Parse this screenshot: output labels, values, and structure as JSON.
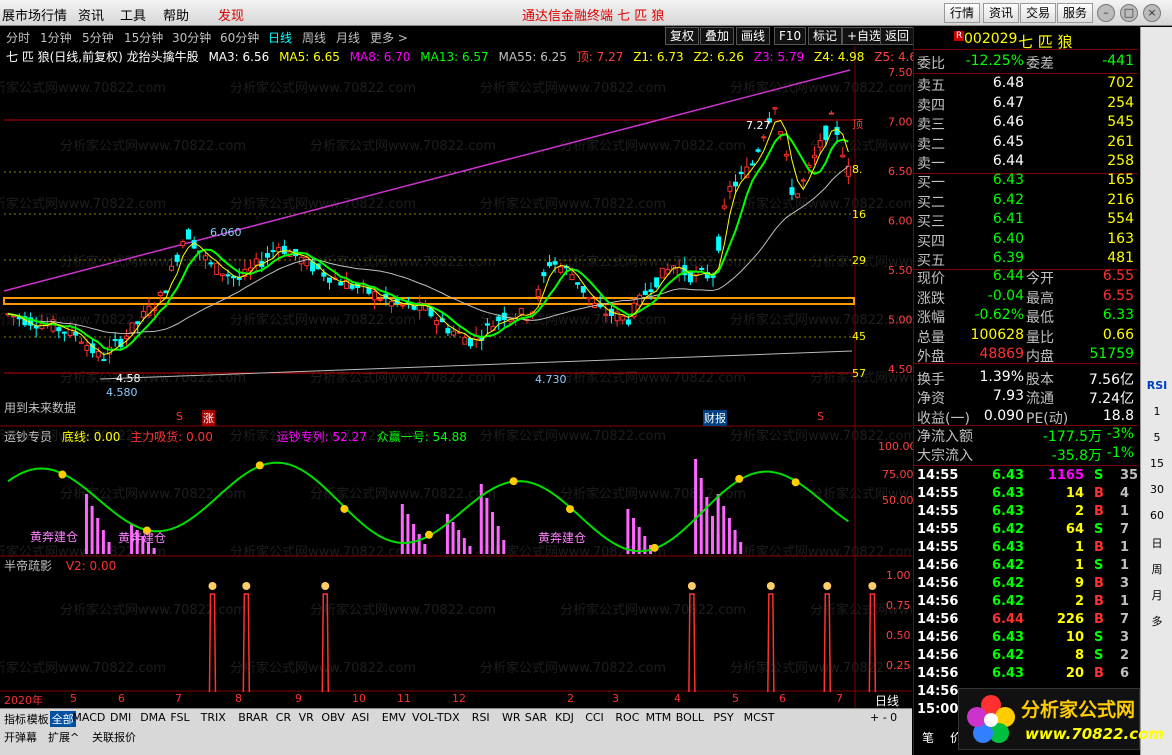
{
  "menu": {
    "items": [
      "展市场行情",
      "资讯",
      "工具",
      "帮助",
      "发现"
    ],
    "title": "通达信金融终端  七 匹 狼",
    "right_buttons": [
      "行情",
      "资讯",
      "交易",
      "服务"
    ]
  },
  "period": {
    "items": [
      "分时",
      "1分钟",
      "5分钟",
      "15分钟",
      "30分钟",
      "日线",
      "周线",
      "月线",
      "更多 >"
    ],
    "active": "日线"
  },
  "toolbtns": [
    "复权",
    "叠加",
    "画线",
    "F10",
    "标记",
    "+自选",
    "返回"
  ],
  "legend": {
    "name": "七 匹 狼(日线,前复权) 龙抬头擒牛股",
    "ma3": "MA3: 6.56",
    "ma5": "MA5: 6.65",
    "ma8": "MA8: 6.70",
    "ma13": "MA13: 6.57",
    "ma55": "MA55: 6.25",
    "ding": "顶: 7.27",
    "z1": "Z1: 6.73",
    "z2": "Z2: 6.26",
    "z3": "Z3: 5.79",
    "z4": "Z4: 4.98",
    "z5": "Z5: 4.6"
  },
  "colors": {
    "ma3": "#ffffff",
    "ma5": "#ffff00",
    "ma8": "#ff00ff",
    "ma13": "#00ff00",
    "ma55": "#c0c0c0",
    "up": "#ff3030",
    "down": "#00ffff",
    "tri": "#cc33cc",
    "support": "#ff9900"
  },
  "price_axis": [
    "7.50",
    "7.00",
    "6.50",
    "6.00",
    "5.50",
    "5.00",
    "4.50"
  ],
  "price_axis_values": [
    7.5,
    7.0,
    6.5,
    6.0,
    5.5,
    5.0,
    4.5
  ],
  "right_marks": [
    "顶",
    "8.",
    "16",
    "29",
    "45",
    "57"
  ],
  "annotations": {
    "high": "7.27",
    "peak1": "6.060",
    "low1": "4.58",
    "low1b": "4.580",
    "low2": "4.730",
    "note": "用到未来数据",
    "zhang": "涨",
    "caibao": "财报",
    "s": "S"
  },
  "ind1": {
    "title": "运钞专员",
    "dx": "底线: 0.00",
    "zl": "主力吸货: 0.00",
    "yc": "运钞专列: 52.27",
    "zy": "众赢一号: 54.88",
    "labels": [
      "黄奔建仓",
      "黄奔建仓",
      "黄奔建仓"
    ],
    "axis": [
      "100.00",
      "75.00",
      "50.00"
    ]
  },
  "ind2": {
    "title": "半帝疏影",
    "v2": "V2: 0.00",
    "axis": [
      "1.00",
      "0.75",
      "0.50",
      "0.25"
    ]
  },
  "xaxis": {
    "labels": [
      "2020年",
      "5",
      "6",
      "7",
      "8",
      "9",
      "10",
      "11",
      "12",
      "2",
      "3",
      "4",
      "5",
      "6",
      "7"
    ],
    "period": "日线"
  },
  "bottom": {
    "row1": [
      "指标",
      "模板",
      "全部",
      "MACD",
      "DMI",
      "DMA",
      "FSL",
      "TRIX",
      "BRAR",
      "CR",
      "VR",
      "OBV",
      "ASI",
      "EMV",
      "VOL-TDX",
      "RSI",
      "WR",
      "SAR",
      "KDJ",
      "CCI",
      "ROC",
      "MTM",
      "BOLL",
      "PSY",
      "MCST"
    ],
    "row2": [
      "开弹幕",
      "扩展^",
      "关联报价"
    ]
  },
  "quote": {
    "code": "002029",
    "name": "七 匹 狼",
    "weibi": {
      "k": "委比",
      "v": "-12.25%",
      "k2": "委差",
      "v2": "-441"
    },
    "asks": [
      {
        "k": "卖五",
        "p": "6.48",
        "v": "702"
      },
      {
        "k": "卖四",
        "p": "6.47",
        "v": "254"
      },
      {
        "k": "卖三",
        "p": "6.46",
        "v": "545"
      },
      {
        "k": "卖二",
        "p": "6.45",
        "v": "261"
      },
      {
        "k": "卖一",
        "p": "6.44",
        "v": "258"
      }
    ],
    "bids": [
      {
        "k": "买一",
        "p": "6.43",
        "v": "165"
      },
      {
        "k": "买二",
        "p": "6.42",
        "v": "216"
      },
      {
        "k": "买三",
        "p": "6.41",
        "v": "554"
      },
      {
        "k": "买四",
        "p": "6.40",
        "v": "163"
      },
      {
        "k": "买五",
        "p": "6.39",
        "v": "481"
      }
    ],
    "stats": [
      [
        "现价",
        "6.44",
        "今开",
        "6.55"
      ],
      [
        "涨跌",
        "-0.04",
        "最高",
        "6.55"
      ],
      [
        "涨幅",
        "-0.62%",
        "最低",
        "6.33"
      ],
      [
        "总量",
        "100628",
        "量比",
        "0.66"
      ],
      [
        "外盘",
        "48869",
        "内盘",
        "51759"
      ],
      [
        "换手",
        "1.39%",
        "股本",
        "7.56亿"
      ],
      [
        "净资",
        "7.93",
        "流通",
        "7.24亿"
      ],
      [
        "收益(一)",
        "0.090",
        "PE(动)",
        "18.8"
      ]
    ],
    "flow": [
      [
        "净流入额",
        "-177.5万",
        "-3%"
      ],
      [
        "大宗流入",
        "-35.8万",
        "-1%"
      ]
    ],
    "ticks": [
      [
        "14:55",
        "6.43",
        "1165",
        "S",
        "35"
      ],
      [
        "14:55",
        "6.43",
        "14",
        "B",
        "4"
      ],
      [
        "14:55",
        "6.43",
        "2",
        "B",
        "1"
      ],
      [
        "14:55",
        "6.42",
        "64",
        "S",
        "7"
      ],
      [
        "14:55",
        "6.43",
        "1",
        "B",
        "1"
      ],
      [
        "14:56",
        "6.42",
        "1",
        "S",
        "1"
      ],
      [
        "14:56",
        "6.42",
        "9",
        "B",
        "3"
      ],
      [
        "14:56",
        "6.42",
        "2",
        "B",
        "1"
      ],
      [
        "14:56",
        "6.44",
        "226",
        "B",
        "7"
      ],
      [
        "14:56",
        "6.43",
        "10",
        "S",
        "3"
      ],
      [
        "14:56",
        "6.42",
        "8",
        "S",
        "2"
      ],
      [
        "14:56",
        "6.43",
        "20",
        "B",
        "6"
      ],
      [
        "14:56",
        "",
        "",
        "",
        ""
      ],
      [
        "15:00",
        "",
        "",
        "",
        ""
      ]
    ],
    "tabs": [
      "笔",
      "价"
    ]
  },
  "sidebar": [
    "RSI",
    "1",
    "5",
    "15",
    "30",
    "60",
    "日",
    "周",
    "月",
    "多"
  ],
  "logo": {
    "text": "分析家公式网",
    "url": "www.70822.com"
  },
  "watermark": "分析家公式网www.70822.com"
}
